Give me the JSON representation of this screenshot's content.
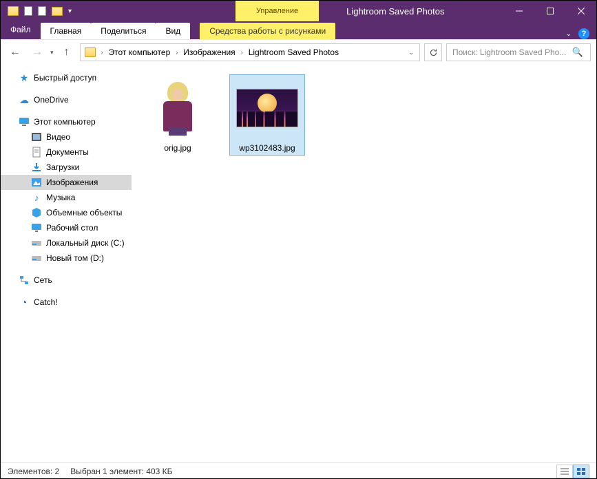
{
  "window": {
    "title": "Lightroom Saved Photos",
    "context_tab_header": "Управление"
  },
  "ribbon": {
    "file": "Файл",
    "tabs": [
      "Главная",
      "Поделиться",
      "Вид"
    ],
    "context_tab": "Средства работы с рисунками"
  },
  "breadcrumb": {
    "segments": [
      "Этот компьютер",
      "Изображения",
      "Lightroom Saved Photos"
    ]
  },
  "search": {
    "placeholder": "Поиск: Lightroom Saved Pho..."
  },
  "sidebar": {
    "quick_access": "Быстрый доступ",
    "onedrive": "OneDrive",
    "this_pc": "Этот компьютер",
    "children": {
      "video": "Видео",
      "documents": "Документы",
      "downloads": "Загрузки",
      "pictures": "Изображения",
      "music": "Музыка",
      "objects3d": "Объемные объекты",
      "desktop": "Рабочий стол",
      "disk_c": "Локальный диск (C:)",
      "disk_d": "Новый том (D:)"
    },
    "network": "Сеть",
    "catch": "Catch!"
  },
  "files": [
    {
      "name": "orig.jpg",
      "selected": false
    },
    {
      "name": "wp3102483.jpg",
      "selected": true
    }
  ],
  "status": {
    "count": "Элементов: 2",
    "selection": "Выбран 1 элемент: 403 КБ"
  }
}
